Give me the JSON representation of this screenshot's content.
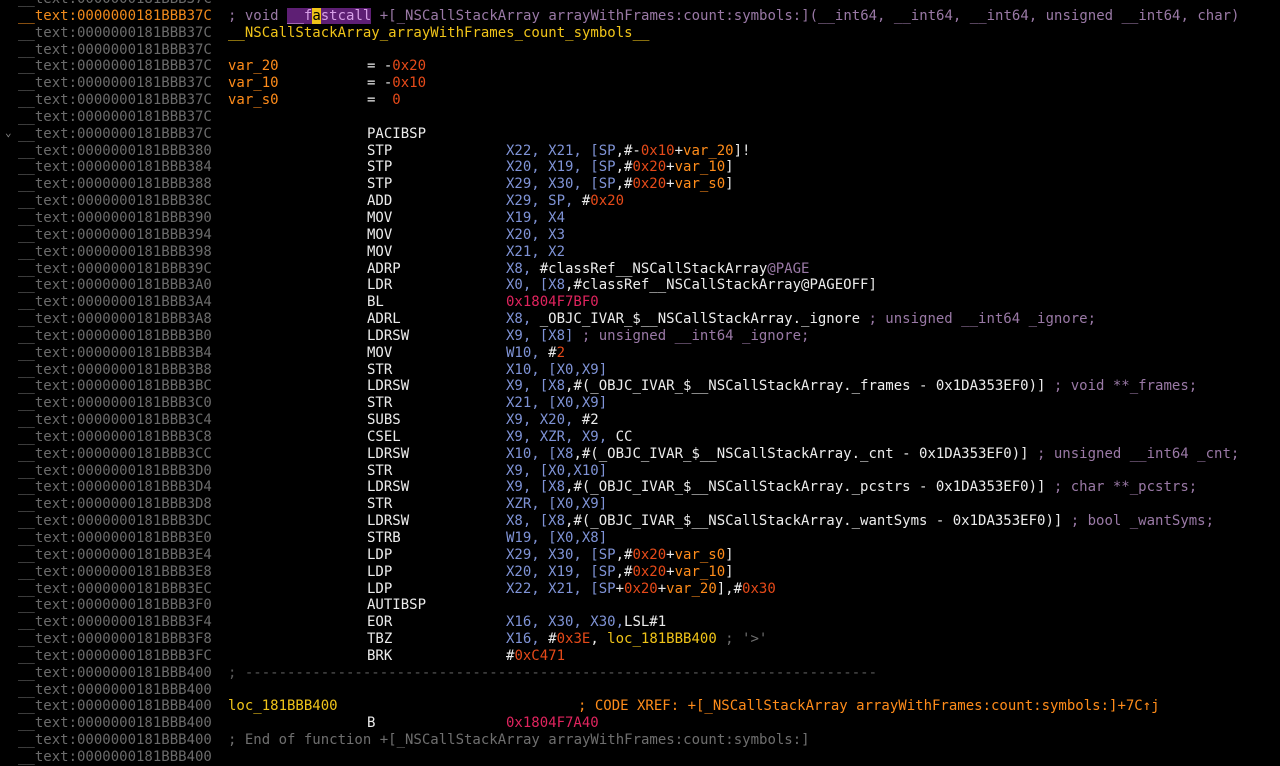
{
  "colors": {
    "background": "#000000",
    "address": "#6b6b6b",
    "address_current": "#f08a1c",
    "instruction": "#ececec",
    "comment": "#9a79a6",
    "number": "#e64a19",
    "variable": "#ff8c1a",
    "register": "#7f93d6",
    "symbol": "#f0c419",
    "branch_target": "#e0245e"
  },
  "rows": [
    {
      "addr": "__text:0000000181BBB37C"
    },
    {
      "addr": "__text:0000000181BBB37C",
      "current": true,
      "full": [
        {
          "t": "; void ",
          "c": "comment"
        },
        {
          "t": "__f",
          "c": "hl"
        },
        {
          "t": "a",
          "c": "cursor"
        },
        {
          "t": "stcall",
          "c": "hl"
        },
        {
          "t": " +[_NSCallStackArray arrayWithFrames:count:symbols:](__int64, __int64, __int64, unsigned __int64, char)",
          "c": "comment"
        }
      ]
    },
    {
      "addr": "__text:0000000181BBB37C",
      "full": [
        {
          "t": "__NSCallStackArray_arrayWithFrames_count_symbols__",
          "c": "fn"
        }
      ]
    },
    {
      "addr": "__text:0000000181BBB37C"
    },
    {
      "addr": "__text:0000000181BBB37C",
      "label": [
        {
          "t": "var_20",
          "c": "var"
        }
      ],
      "mnem": [
        {
          "t": "= -",
          "c": "default"
        },
        {
          "t": "0x20",
          "c": "num"
        }
      ]
    },
    {
      "addr": "__text:0000000181BBB37C",
      "label": [
        {
          "t": "var_10",
          "c": "var"
        }
      ],
      "mnem": [
        {
          "t": "= -",
          "c": "default"
        },
        {
          "t": "0x10",
          "c": "num"
        }
      ]
    },
    {
      "addr": "__text:0000000181BBB37C",
      "label": [
        {
          "t": "var_s0",
          "c": "var"
        }
      ],
      "mnem": [
        {
          "t": "=  ",
          "c": "default"
        },
        {
          "t": "0",
          "c": "num"
        }
      ]
    },
    {
      "addr": "__text:0000000181BBB37C"
    },
    {
      "addr": "__text:0000000181BBB37C",
      "fold": "⌄",
      "mnem": [
        {
          "t": "PACIBSP",
          "c": "default"
        }
      ]
    },
    {
      "addr": "__text:0000000181BBB380",
      "mnem": [
        {
          "t": "STP",
          "c": "default"
        }
      ],
      "ops": [
        {
          "t": "X22, X21, [",
          "c": "reg"
        },
        {
          "t": "SP",
          "c": "reg"
        },
        {
          "t": ",#-",
          "c": "default"
        },
        {
          "t": "0x10",
          "c": "num"
        },
        {
          "t": "+",
          "c": "default"
        },
        {
          "t": "var_20",
          "c": "var"
        },
        {
          "t": "]!",
          "c": "default"
        }
      ]
    },
    {
      "addr": "__text:0000000181BBB384",
      "mnem": [
        {
          "t": "STP",
          "c": "default"
        }
      ],
      "ops": [
        {
          "t": "X20, X19, [SP",
          "c": "reg"
        },
        {
          "t": ",#",
          "c": "default"
        },
        {
          "t": "0x20",
          "c": "num"
        },
        {
          "t": "+",
          "c": "default"
        },
        {
          "t": "var_10",
          "c": "var"
        },
        {
          "t": "]",
          "c": "default"
        }
      ]
    },
    {
      "addr": "__text:0000000181BBB388",
      "mnem": [
        {
          "t": "STP",
          "c": "default"
        }
      ],
      "ops": [
        {
          "t": "X29, X30, [SP",
          "c": "reg"
        },
        {
          "t": ",#",
          "c": "default"
        },
        {
          "t": "0x20",
          "c": "num"
        },
        {
          "t": "+",
          "c": "default"
        },
        {
          "t": "var_s0",
          "c": "var"
        },
        {
          "t": "]",
          "c": "default"
        }
      ]
    },
    {
      "addr": "__text:0000000181BBB38C",
      "mnem": [
        {
          "t": "ADD",
          "c": "default"
        }
      ],
      "ops": [
        {
          "t": "X29, SP, ",
          "c": "reg"
        },
        {
          "t": "#",
          "c": "default"
        },
        {
          "t": "0x20",
          "c": "num"
        }
      ]
    },
    {
      "addr": "__text:0000000181BBB390",
      "mnem": [
        {
          "t": "MOV",
          "c": "default"
        }
      ],
      "ops": [
        {
          "t": "X19, X4",
          "c": "reg"
        }
      ]
    },
    {
      "addr": "__text:0000000181BBB394",
      "mnem": [
        {
          "t": "MOV",
          "c": "default"
        }
      ],
      "ops": [
        {
          "t": "X20, X3",
          "c": "reg"
        }
      ]
    },
    {
      "addr": "__text:0000000181BBB398",
      "mnem": [
        {
          "t": "MOV",
          "c": "default"
        }
      ],
      "ops": [
        {
          "t": "X21, X2",
          "c": "reg"
        }
      ]
    },
    {
      "addr": "__text:0000000181BBB39C",
      "mnem": [
        {
          "t": "ADRP",
          "c": "default"
        }
      ],
      "ops": [
        {
          "t": "X8, ",
          "c": "reg"
        },
        {
          "t": "#classRef__NSCallStackArray",
          "c": "default"
        },
        {
          "t": "@PAGE",
          "c": "comment"
        }
      ]
    },
    {
      "addr": "__text:0000000181BBB3A0",
      "mnem": [
        {
          "t": "LDR",
          "c": "default"
        }
      ],
      "ops": [
        {
          "t": "X0, [X8",
          "c": "reg"
        },
        {
          "t": ",#classRef__NSCallStackArray@PAGEOFF]",
          "c": "default"
        }
      ]
    },
    {
      "addr": "__text:0000000181BBB3A4",
      "mnem": [
        {
          "t": "BL",
          "c": "default"
        }
      ],
      "ops": [
        {
          "t": "0x1804F7BF0",
          "c": "addr"
        }
      ]
    },
    {
      "addr": "__text:0000000181BBB3A8",
      "mnem": [
        {
          "t": "ADRL",
          "c": "default"
        }
      ],
      "ops": [
        {
          "t": "X8, ",
          "c": "reg"
        },
        {
          "t": "_OBJC_IVAR_$__NSCallStackArray._ignore",
          "c": "default"
        },
        {
          "t": " ; unsigned __int64 _ignore;",
          "c": "comment"
        }
      ]
    },
    {
      "addr": "__text:0000000181BBB3B0",
      "mnem": [
        {
          "t": "LDRSW",
          "c": "default"
        }
      ],
      "ops": [
        {
          "t": "X9, [X8]",
          "c": "reg"
        },
        {
          "t": " ; unsigned __int64 _ignore;",
          "c": "comment"
        }
      ]
    },
    {
      "addr": "__text:0000000181BBB3B4",
      "mnem": [
        {
          "t": "MOV",
          "c": "default"
        }
      ],
      "ops": [
        {
          "t": "W10, ",
          "c": "reg"
        },
        {
          "t": "#",
          "c": "default"
        },
        {
          "t": "2",
          "c": "num"
        }
      ]
    },
    {
      "addr": "__text:0000000181BBB3B8",
      "mnem": [
        {
          "t": "STR",
          "c": "default"
        }
      ],
      "ops": [
        {
          "t": "X10, [X0,X9]",
          "c": "reg"
        }
      ]
    },
    {
      "addr": "__text:0000000181BBB3BC",
      "mnem": [
        {
          "t": "LDRSW",
          "c": "default"
        }
      ],
      "ops": [
        {
          "t": "X9, [X8",
          "c": "reg"
        },
        {
          "t": ",#(_OBJC_IVAR_$__NSCallStackArray._frames - 0x1DA353EF0)]",
          "c": "default"
        },
        {
          "t": " ; void **_frames;",
          "c": "comment"
        }
      ]
    },
    {
      "addr": "__text:0000000181BBB3C0",
      "mnem": [
        {
          "t": "STR",
          "c": "default"
        }
      ],
      "ops": [
        {
          "t": "X21, [X0,X9]",
          "c": "reg"
        }
      ]
    },
    {
      "addr": "__text:0000000181BBB3C4",
      "mnem": [
        {
          "t": "SUBS",
          "c": "default"
        }
      ],
      "ops": [
        {
          "t": "X9, X20, ",
          "c": "reg"
        },
        {
          "t": "#2",
          "c": "default"
        }
      ]
    },
    {
      "addr": "__text:0000000181BBB3C8",
      "mnem": [
        {
          "t": "CSEL",
          "c": "default"
        }
      ],
      "ops": [
        {
          "t": "X9, XZR, X9, ",
          "c": "reg"
        },
        {
          "t": "CC",
          "c": "default"
        }
      ]
    },
    {
      "addr": "__text:0000000181BBB3CC",
      "mnem": [
        {
          "t": "LDRSW",
          "c": "default"
        }
      ],
      "ops": [
        {
          "t": "X10, [X8",
          "c": "reg"
        },
        {
          "t": ",#(_OBJC_IVAR_$__NSCallStackArray._cnt - 0x1DA353EF0)]",
          "c": "default"
        },
        {
          "t": " ; unsigned __int64 _cnt;",
          "c": "comment"
        }
      ]
    },
    {
      "addr": "__text:0000000181BBB3D0",
      "mnem": [
        {
          "t": "STR",
          "c": "default"
        }
      ],
      "ops": [
        {
          "t": "X9, [X0,X10]",
          "c": "reg"
        }
      ]
    },
    {
      "addr": "__text:0000000181BBB3D4",
      "mnem": [
        {
          "t": "LDRSW",
          "c": "default"
        }
      ],
      "ops": [
        {
          "t": "X9, [X8",
          "c": "reg"
        },
        {
          "t": ",#(_OBJC_IVAR_$__NSCallStackArray._pcstrs - 0x1DA353EF0)]",
          "c": "default"
        },
        {
          "t": " ; char **_pcstrs;",
          "c": "comment"
        }
      ]
    },
    {
      "addr": "__text:0000000181BBB3D8",
      "mnem": [
        {
          "t": "STR",
          "c": "default"
        }
      ],
      "ops": [
        {
          "t": "XZR, [X0,X9]",
          "c": "reg"
        }
      ]
    },
    {
      "addr": "__text:0000000181BBB3DC",
      "mnem": [
        {
          "t": "LDRSW",
          "c": "default"
        }
      ],
      "ops": [
        {
          "t": "X8, [X8",
          "c": "reg"
        },
        {
          "t": ",#(_OBJC_IVAR_$__NSCallStackArray._wantSyms - 0x1DA353EF0)]",
          "c": "default"
        },
        {
          "t": " ; bool _wantSyms;",
          "c": "comment"
        }
      ]
    },
    {
      "addr": "__text:0000000181BBB3E0",
      "mnem": [
        {
          "t": "STRB",
          "c": "default"
        }
      ],
      "ops": [
        {
          "t": "W19, [X0,X8]",
          "c": "reg"
        }
      ]
    },
    {
      "addr": "__text:0000000181BBB3E4",
      "mnem": [
        {
          "t": "LDP",
          "c": "default"
        }
      ],
      "ops": [
        {
          "t": "X29, X30, [SP",
          "c": "reg"
        },
        {
          "t": ",#",
          "c": "default"
        },
        {
          "t": "0x20",
          "c": "num"
        },
        {
          "t": "+",
          "c": "default"
        },
        {
          "t": "var_s0",
          "c": "var"
        },
        {
          "t": "]",
          "c": "default"
        }
      ]
    },
    {
      "addr": "__text:0000000181BBB3E8",
      "mnem": [
        {
          "t": "LDP",
          "c": "default"
        }
      ],
      "ops": [
        {
          "t": "X20, X19, [SP",
          "c": "reg"
        },
        {
          "t": ",#",
          "c": "default"
        },
        {
          "t": "0x20",
          "c": "num"
        },
        {
          "t": "+",
          "c": "default"
        },
        {
          "t": "var_10",
          "c": "var"
        },
        {
          "t": "]",
          "c": "default"
        }
      ]
    },
    {
      "addr": "__text:0000000181BBB3EC",
      "mnem": [
        {
          "t": "LDP",
          "c": "default"
        }
      ],
      "ops": [
        {
          "t": "X22, X21, [SP",
          "c": "reg"
        },
        {
          "t": "+",
          "c": "default"
        },
        {
          "t": "0x20",
          "c": "num"
        },
        {
          "t": "+",
          "c": "default"
        },
        {
          "t": "var_20",
          "c": "var"
        },
        {
          "t": "],#",
          "c": "default"
        },
        {
          "t": "0x30",
          "c": "num"
        }
      ]
    },
    {
      "addr": "__text:0000000181BBB3F0",
      "mnem": [
        {
          "t": "AUTIBSP",
          "c": "default"
        }
      ]
    },
    {
      "addr": "__text:0000000181BBB3F4",
      "mnem": [
        {
          "t": "EOR",
          "c": "default"
        }
      ],
      "ops": [
        {
          "t": "X16, X30, X30,",
          "c": "reg"
        },
        {
          "t": "LSL#1",
          "c": "default"
        }
      ]
    },
    {
      "addr": "__text:0000000181BBB3F8",
      "mnem": [
        {
          "t": "TBZ",
          "c": "default"
        }
      ],
      "ops": [
        {
          "t": "X16, ",
          "c": "reg"
        },
        {
          "t": "#",
          "c": "default"
        },
        {
          "t": "0x3E",
          "c": "num"
        },
        {
          "t": ", ",
          "c": "default"
        },
        {
          "t": "loc_181BBB400",
          "c": "sym"
        },
        {
          "t": " ; '>'",
          "c": "cmtgray"
        }
      ]
    },
    {
      "addr": "__text:0000000181BBB3FC",
      "mnem": [
        {
          "t": "BRK",
          "c": "default"
        }
      ],
      "ops": [
        {
          "t": "#",
          "c": "default"
        },
        {
          "t": "0xC471",
          "c": "num"
        }
      ]
    },
    {
      "addr": "__text:0000000181BBB400",
      "full": [
        {
          "t": "; ---------------------------------------------------------------------------",
          "c": "sep"
        }
      ]
    },
    {
      "addr": "__text:0000000181BBB400"
    },
    {
      "addr": "__text:0000000181BBB400",
      "label": [
        {
          "t": "loc_181BBB400",
          "c": "fn"
        }
      ],
      "xref": [
        {
          "t": "; CODE XREF: +[_NSCallStackArray arrayWithFrames:count:symbols:]+7C↑j",
          "c": "xref"
        }
      ]
    },
    {
      "addr": "__text:0000000181BBB400",
      "mnem": [
        {
          "t": "B",
          "c": "default"
        }
      ],
      "ops": [
        {
          "t": "0x1804F7A40",
          "c": "addr"
        }
      ]
    },
    {
      "addr": "__text:0000000181BBB400",
      "full": [
        {
          "t": "; End of function +[_NSCallStackArray arrayWithFrames:count:symbols:]",
          "c": "cmtgray"
        }
      ]
    },
    {
      "addr": "__text:0000000181BBB400"
    }
  ]
}
